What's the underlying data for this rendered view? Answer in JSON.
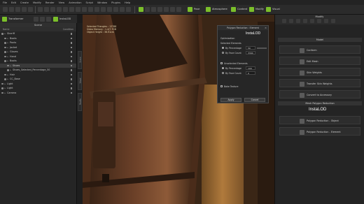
{
  "menu": [
    "File",
    "Edit",
    "Create",
    "Modify",
    "Render",
    "View",
    "Animation",
    "Script",
    "Window",
    "Plugins",
    "Help"
  ],
  "toolbar": {
    "transformer_label": "Transformer",
    "instaLOD_label": "InstaLOD",
    "pose_label": "Pose",
    "atmosphere_label": "Atmosphere",
    "content_label": "Content",
    "modify_label": "Modify",
    "visual_label": "Visual"
  },
  "scene": {
    "title": "Scene",
    "col_name": "Name",
    "col_condition": "Condition",
    "items": [
      {
        "label": "Sheriff",
        "indent": 0,
        "selected": false
      },
      {
        "label": "Boots",
        "indent": 1,
        "selected": false
      },
      {
        "label": "Pants",
        "indent": 1,
        "selected": false
      },
      {
        "label": "Jacket",
        "indent": 1,
        "selected": false
      },
      {
        "label": "Gloves",
        "indent": 1,
        "selected": false
      },
      {
        "label": "Hand",
        "indent": 1,
        "selected": false
      },
      {
        "label": "Boots",
        "indent": 1,
        "selected": false
      },
      {
        "label": "Shoes",
        "indent": 2,
        "selected": true
      },
      {
        "label": "Shoes_Selected_Percentage_50",
        "indent": 2,
        "selected": false
      },
      {
        "label": "Hair",
        "indent": 1,
        "selected": false
      },
      {
        "label": "CC_Base",
        "indent": 1,
        "selected": false
      },
      {
        "label": "Light",
        "indent": 0,
        "selected": false
      },
      {
        "label": "Light",
        "indent": 0,
        "selected": false
      },
      {
        "label": "Camera",
        "indent": 0,
        "selected": false
      }
    ]
  },
  "side_tabs": [
    "Scene",
    "Visual",
    "Modify"
  ],
  "viewport": {
    "stats": [
      "Selected Triangles : 13788",
      "Video Memory : 1.4/7.7GB",
      "Object Height : 36.91cm"
    ]
  },
  "dialog": {
    "title": "Polygon Reduction : Element",
    "close": "×",
    "logo": "InstaLOD",
    "optimization": "Optimization",
    "selected_elements": "Selected Elements",
    "by_percentage": "By Percentage",
    "percentage_value": "50",
    "by_face_count": "By Face Count",
    "face_value": "3394",
    "unselected_elements": "Unselected Elements",
    "by_percentage_2": "By Percentage",
    "percentage_value_2": "100",
    "by_face_count_2": "By Face Count",
    "face_value_2": "0",
    "bake_texture": "Bake Texture",
    "apply": "Apply",
    "cancel": "Cancel"
  },
  "right": {
    "title": "Modify",
    "section_model": "Model",
    "buttons": [
      "Conform",
      "Edit Mesh",
      "Skin Weights",
      "Transfer Skin Weights",
      "Convert to Accessory"
    ],
    "section_poly": "Mesh Polygon Reduction",
    "logo": "InstaLOD",
    "poly_buttons": [
      "Polygon Reduction - Object",
      "Polygon Reduction - Element"
    ]
  },
  "colors": {
    "accent": "#7bbf2a"
  }
}
